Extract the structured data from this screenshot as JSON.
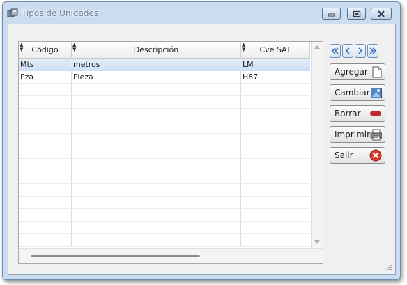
{
  "window": {
    "title": "Tipos de Unidades",
    "icons": [
      "app-icon",
      "minimize-icon",
      "maximize-icon",
      "close-icon"
    ]
  },
  "grid": {
    "columns": [
      "Código",
      "Descripción",
      "Cve SAT"
    ],
    "rows": [
      {
        "codigo": "Mts",
        "descripcion": "metros",
        "cve_sat": "LM"
      },
      {
        "codigo": "Pza",
        "descripcion": "Pieza",
        "cve_sat": "H87"
      }
    ],
    "selected_row": 0
  },
  "nav": {
    "icons": [
      "first-record-icon",
      "previous-record-icon",
      "next-record-icon",
      "last-record-icon"
    ]
  },
  "actions": {
    "add_label": "Agregar",
    "change_label": "Cambiar",
    "delete_label": "Borrar",
    "print_label": "Imprimir",
    "exit_label": "Salir"
  },
  "colors": {
    "window_frame": "#c9dcf0",
    "selected_row": "#d6e5f8",
    "delete_red": "#c0282d",
    "exit_red": "#d93b30"
  }
}
